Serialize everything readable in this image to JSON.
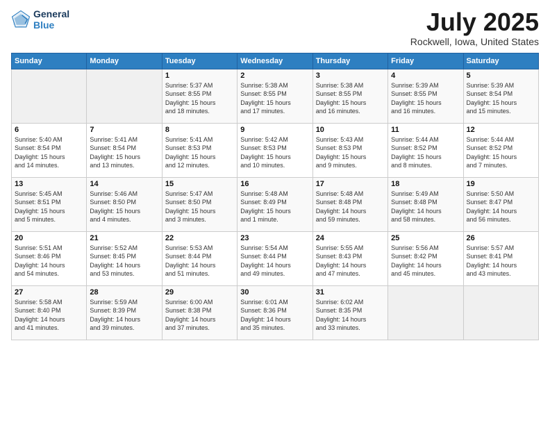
{
  "logo": {
    "line1": "General",
    "line2": "Blue"
  },
  "title": "July 2025",
  "location": "Rockwell, Iowa, United States",
  "days_of_week": [
    "Sunday",
    "Monday",
    "Tuesday",
    "Wednesday",
    "Thursday",
    "Friday",
    "Saturday"
  ],
  "weeks": [
    [
      {
        "day": "",
        "info": ""
      },
      {
        "day": "",
        "info": ""
      },
      {
        "day": "1",
        "info": "Sunrise: 5:37 AM\nSunset: 8:55 PM\nDaylight: 15 hours\nand 18 minutes."
      },
      {
        "day": "2",
        "info": "Sunrise: 5:38 AM\nSunset: 8:55 PM\nDaylight: 15 hours\nand 17 minutes."
      },
      {
        "day": "3",
        "info": "Sunrise: 5:38 AM\nSunset: 8:55 PM\nDaylight: 15 hours\nand 16 minutes."
      },
      {
        "day": "4",
        "info": "Sunrise: 5:39 AM\nSunset: 8:55 PM\nDaylight: 15 hours\nand 16 minutes."
      },
      {
        "day": "5",
        "info": "Sunrise: 5:39 AM\nSunset: 8:54 PM\nDaylight: 15 hours\nand 15 minutes."
      }
    ],
    [
      {
        "day": "6",
        "info": "Sunrise: 5:40 AM\nSunset: 8:54 PM\nDaylight: 15 hours\nand 14 minutes."
      },
      {
        "day": "7",
        "info": "Sunrise: 5:41 AM\nSunset: 8:54 PM\nDaylight: 15 hours\nand 13 minutes."
      },
      {
        "day": "8",
        "info": "Sunrise: 5:41 AM\nSunset: 8:53 PM\nDaylight: 15 hours\nand 12 minutes."
      },
      {
        "day": "9",
        "info": "Sunrise: 5:42 AM\nSunset: 8:53 PM\nDaylight: 15 hours\nand 10 minutes."
      },
      {
        "day": "10",
        "info": "Sunrise: 5:43 AM\nSunset: 8:53 PM\nDaylight: 15 hours\nand 9 minutes."
      },
      {
        "day": "11",
        "info": "Sunrise: 5:44 AM\nSunset: 8:52 PM\nDaylight: 15 hours\nand 8 minutes."
      },
      {
        "day": "12",
        "info": "Sunrise: 5:44 AM\nSunset: 8:52 PM\nDaylight: 15 hours\nand 7 minutes."
      }
    ],
    [
      {
        "day": "13",
        "info": "Sunrise: 5:45 AM\nSunset: 8:51 PM\nDaylight: 15 hours\nand 5 minutes."
      },
      {
        "day": "14",
        "info": "Sunrise: 5:46 AM\nSunset: 8:50 PM\nDaylight: 15 hours\nand 4 minutes."
      },
      {
        "day": "15",
        "info": "Sunrise: 5:47 AM\nSunset: 8:50 PM\nDaylight: 15 hours\nand 3 minutes."
      },
      {
        "day": "16",
        "info": "Sunrise: 5:48 AM\nSunset: 8:49 PM\nDaylight: 15 hours\nand 1 minute."
      },
      {
        "day": "17",
        "info": "Sunrise: 5:48 AM\nSunset: 8:48 PM\nDaylight: 14 hours\nand 59 minutes."
      },
      {
        "day": "18",
        "info": "Sunrise: 5:49 AM\nSunset: 8:48 PM\nDaylight: 14 hours\nand 58 minutes."
      },
      {
        "day": "19",
        "info": "Sunrise: 5:50 AM\nSunset: 8:47 PM\nDaylight: 14 hours\nand 56 minutes."
      }
    ],
    [
      {
        "day": "20",
        "info": "Sunrise: 5:51 AM\nSunset: 8:46 PM\nDaylight: 14 hours\nand 54 minutes."
      },
      {
        "day": "21",
        "info": "Sunrise: 5:52 AM\nSunset: 8:45 PM\nDaylight: 14 hours\nand 53 minutes."
      },
      {
        "day": "22",
        "info": "Sunrise: 5:53 AM\nSunset: 8:44 PM\nDaylight: 14 hours\nand 51 minutes."
      },
      {
        "day": "23",
        "info": "Sunrise: 5:54 AM\nSunset: 8:44 PM\nDaylight: 14 hours\nand 49 minutes."
      },
      {
        "day": "24",
        "info": "Sunrise: 5:55 AM\nSunset: 8:43 PM\nDaylight: 14 hours\nand 47 minutes."
      },
      {
        "day": "25",
        "info": "Sunrise: 5:56 AM\nSunset: 8:42 PM\nDaylight: 14 hours\nand 45 minutes."
      },
      {
        "day": "26",
        "info": "Sunrise: 5:57 AM\nSunset: 8:41 PM\nDaylight: 14 hours\nand 43 minutes."
      }
    ],
    [
      {
        "day": "27",
        "info": "Sunrise: 5:58 AM\nSunset: 8:40 PM\nDaylight: 14 hours\nand 41 minutes."
      },
      {
        "day": "28",
        "info": "Sunrise: 5:59 AM\nSunset: 8:39 PM\nDaylight: 14 hours\nand 39 minutes."
      },
      {
        "day": "29",
        "info": "Sunrise: 6:00 AM\nSunset: 8:38 PM\nDaylight: 14 hours\nand 37 minutes."
      },
      {
        "day": "30",
        "info": "Sunrise: 6:01 AM\nSunset: 8:36 PM\nDaylight: 14 hours\nand 35 minutes."
      },
      {
        "day": "31",
        "info": "Sunrise: 6:02 AM\nSunset: 8:35 PM\nDaylight: 14 hours\nand 33 minutes."
      },
      {
        "day": "",
        "info": ""
      },
      {
        "day": "",
        "info": ""
      }
    ]
  ]
}
